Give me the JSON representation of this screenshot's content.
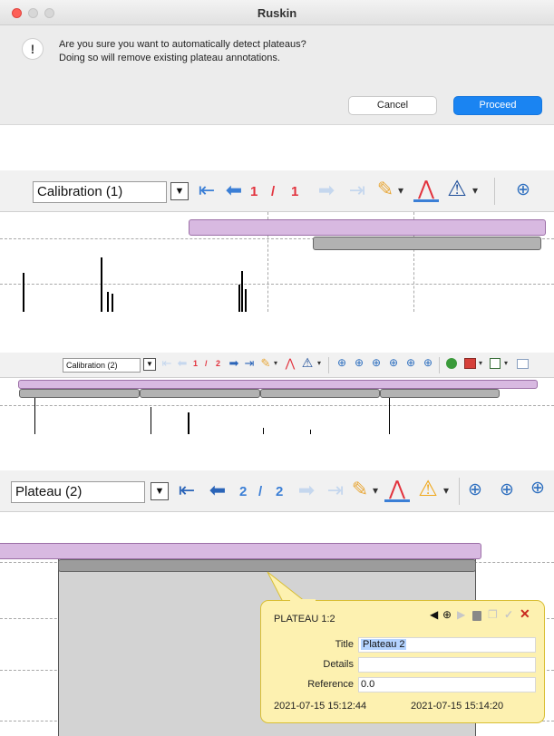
{
  "dialog": {
    "title": "Ruskin",
    "icon": "!",
    "message_line1": "Are you sure you want to automatically detect plateaus?",
    "message_line2": "Doing so will remove existing plateau annotations.",
    "cancel_label": "Cancel",
    "proceed_label": "Proceed"
  },
  "toolbar1": {
    "combo": "Calibration (1)",
    "page_current": "1",
    "page_sep": "/",
    "page_total": "1"
  },
  "toolbar2": {
    "combo": "Calibration (2)",
    "page_current": "1",
    "page_sep": "/",
    "page_total": "2"
  },
  "toolbar3": {
    "combo": "Plateau (2)",
    "page_current": "2",
    "page_sep": "/",
    "page_total": "2"
  },
  "glyphs": {
    "dropdown": "▼",
    "first": "⇤",
    "prev": "⬅",
    "next": "➡",
    "last": "⇥",
    "pen": "✎",
    "caret": "▾",
    "peak": "⋀",
    "warn": "⚠",
    "zoom": "⊕"
  },
  "popup": {
    "heading": "PLATEAU 1:2",
    "title_label": "Title",
    "title_value": "Plateau 2",
    "details_label": "Details",
    "details_value": "",
    "reference_label": "Reference",
    "reference_value": "0.0",
    "start_time": "2021-07-15 15:12:44",
    "end_time": "2021-07-15 15:14:20",
    "icons": {
      "prev": "◀",
      "target": "⊕",
      "next": "▶",
      "delete": "🗑",
      "copy": "❐",
      "check": "✓",
      "close": "✕"
    }
  },
  "colors": {
    "accent_blue": "#1a84f2",
    "page_red": "#e2323d",
    "plateau": "#d8b9e1",
    "calibration": "#b2b2b2",
    "popup_bg": "#fdf1b0"
  },
  "icon_names": [
    "first-page-icon",
    "prev-page-icon",
    "next-page-icon",
    "last-page-icon",
    "pen-icon",
    "peak-icon",
    "warning-icon",
    "zoom-icon",
    "delete-icon",
    "close-icon"
  ]
}
